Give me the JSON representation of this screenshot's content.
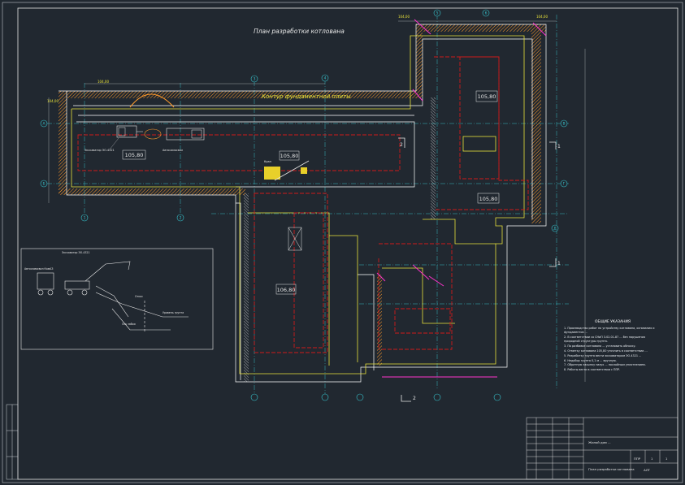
{
  "drawing": {
    "title": "План разработки котлована",
    "plate_contour_label": "Контур фундаментной плиты",
    "colors": {
      "background": "#212830",
      "frame": "#e6e6e6",
      "axis_grid": "#37c6d0",
      "excavation": "#ffffff",
      "plate_contour": "#e8e23a",
      "slab_outline": "#d01a1a",
      "hatch": "#ff9a2b",
      "pile": "#ff33cc",
      "structure": "#7be37b"
    },
    "elevation_tags": [
      "105,80",
      "105,80",
      "105,80",
      "105,80",
      "106,80"
    ],
    "grade_labels": [
      "104,00",
      "104,00",
      "104,00",
      "104,00"
    ],
    "section_marks": [
      "1",
      "1",
      "2",
      "2"
    ],
    "axis_bubbles_top": [
      "1",
      "2",
      "3",
      "4",
      "5",
      "6"
    ],
    "axis_bubbles_left": [
      "А",
      "Б",
      "В",
      "Г",
      "Д"
    ],
    "callouts": [
      "Экскаватор ЭО-4321",
      "Автосамосвал",
      "Кран"
    ],
    "detail_labels": [
      "Экскаватор ЭО-4321",
      "Автосамосвал КамАЗ",
      "Откос",
      "Уровень грунта",
      "Ось забоя"
    ]
  },
  "notes": {
    "title": "ОБЩИЕ УКАЗАНИЯ",
    "items": [
      "1. Производство работ по устройству котлована, основания и фундаментов ...",
      "2. В соответствии со СНиП 3.02.01-87 ... без нарушения природной структуры грунта.",
      "3. По разбивке котлована ... установить обноску.",
      "4. Отметку котлована 105,80 уточнить в соответствии ...",
      "5. Разработку грунта вести экскаватором ЭО-4321 ...",
      "6. Недобор грунта 0,1 м ... вручную.",
      "7. Обратную засыпку пазух ... послойным уплотнением.",
      "8. Работы вести в соответствии с ППР."
    ]
  },
  "title_block": {
    "project": "Жилой дом ...",
    "sheet_title": "План разработки котлована",
    "stage": "ППР",
    "sheet": "1",
    "sheets": "1",
    "org": "АЛТ"
  }
}
